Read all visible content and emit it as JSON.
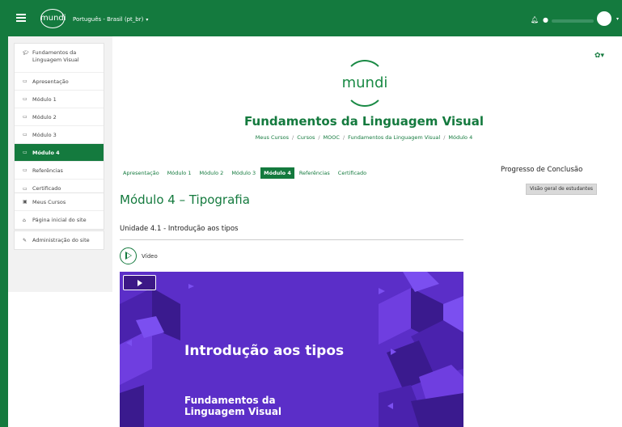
{
  "navbar": {
    "logo": "mundi",
    "language": "Português - Brasil (pt_br)",
    "icons": [
      "menu-icon",
      "bell-icon",
      "chat-icon"
    ]
  },
  "drawer": {
    "course": "Fundamentos da Linguagem Visual",
    "sections": [
      {
        "label": "Apresentação",
        "active": false
      },
      {
        "label": "Módulo 1",
        "active": false
      },
      {
        "label": "Módulo 2",
        "active": false
      },
      {
        "label": "Módulo 3",
        "active": false
      },
      {
        "label": "Módulo 4",
        "active": true
      },
      {
        "label": "Referências",
        "active": false
      },
      {
        "label": "Certificado",
        "active": false
      }
    ],
    "my_courses": "Meus Cursos",
    "site_home": "Página inicial do site",
    "admin": "Administração do site"
  },
  "header": {
    "logo_word": "mundi",
    "course_title": "Fundamentos da Linguagem Visual",
    "breadcrumb": [
      "Meus Cursos",
      "Cursos",
      "MOOC",
      "Fundamentos da Linguagem Visual",
      "Módulo 4"
    ]
  },
  "tabs": [
    {
      "label": "Apresentação",
      "active": false
    },
    {
      "label": "Módulo 1",
      "active": false
    },
    {
      "label": "Módulo 2",
      "active": false
    },
    {
      "label": "Módulo 3",
      "active": false
    },
    {
      "label": "Módulo 4",
      "active": true
    },
    {
      "label": "Referências",
      "active": false
    },
    {
      "label": "Certificado",
      "active": false
    }
  ],
  "progress": {
    "title": "Progresso de Conclusão",
    "button": "Visão geral de estudantes"
  },
  "main": {
    "section_title": "Módulo 4 – Tipografia",
    "unit_title": "Unidade 4.1 - Introdução aos tipos",
    "video_label": "Vídeo",
    "video_heading": "Introdução aos tipos",
    "video_sub": "Fundamentos da Linguagem Visual"
  },
  "colors": {
    "brand": "#147a3e",
    "video_bg": "#5b2ec8"
  }
}
